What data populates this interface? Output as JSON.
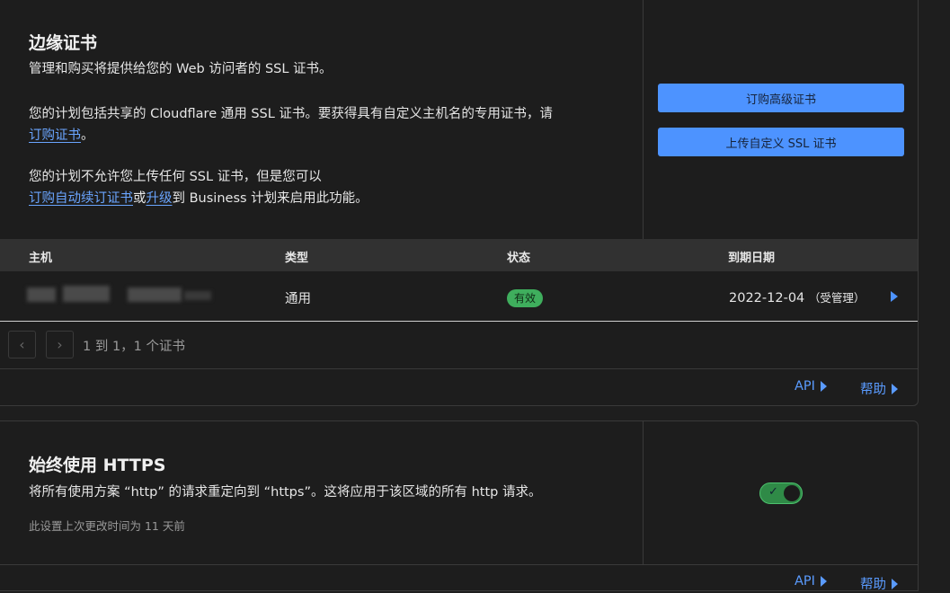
{
  "ssl": {
    "title": "边缘证书",
    "description": "管理和购买将提供给您的 Web 访问者的 SSL 证书。",
    "plan_text": "您的计划包括共享的 Cloudflare 通用 SSL 证书。要获得具有自定义主机名的专用证书，请",
    "plan_link": "订购证书",
    "plan_end": "。",
    "upload_text": "您的计划不允许您上传任何 SSL 证书，但是您可以",
    "upload_link1": "订购自动续订证书",
    "upload_or": "或",
    "upload_link2": "升级",
    "upload_end": "到 Business 计划来启用此功能。",
    "btn_order": "订购高级证书",
    "btn_upload": "上传自定义 SSL 证书",
    "table": {
      "headers": [
        "主机",
        "类型",
        "状态",
        "到期日期"
      ],
      "rows": [
        {
          "host": "",
          "type": "通用",
          "status": "有效",
          "expiry": "2022-12-04",
          "expiry_note": "（受管理）"
        }
      ]
    },
    "pager": {
      "prev": "‹",
      "next": "›",
      "range": "1 到 1，1 个证书"
    },
    "footer": {
      "api": "API",
      "help": "帮助"
    }
  },
  "https": {
    "title": "始终使用 HTTPS",
    "description": "将所有使用方案 “http” 的请求重定向到 “https”。这将应用于该区域的所有 http 请求。",
    "last_changed": "此设置上次更改时间为 11 天前",
    "toggle_on": true,
    "toggle_check": "✓",
    "footer": {
      "api": "API",
      "help": "帮助"
    }
  },
  "colors": {
    "accent": "#4d93ff",
    "success": "#3fae5d",
    "link": "#6aa5ff"
  }
}
